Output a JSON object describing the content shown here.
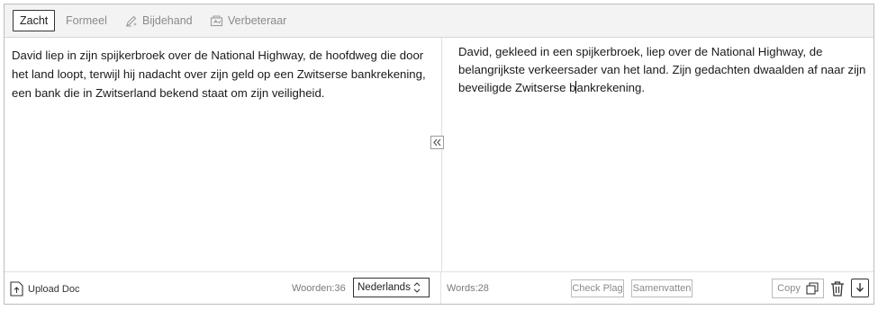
{
  "tabs": [
    {
      "label": "Zacht",
      "active": true
    },
    {
      "label": "Formeel",
      "active": false
    },
    {
      "label": "Bijdehand",
      "active": false,
      "icon": "pen-sparkle-icon"
    },
    {
      "label": "Verbeteraar",
      "active": false,
      "icon": "proofread-icon"
    }
  ],
  "input": {
    "text": "David liep in zijn spijkerbroek over de National Highway, de hoofdweg die door het land loopt, terwijl hij nadacht over zijn geld op een Zwitserse bankrekening, een bank die in Zwitserland bekend staat om zijn veiligheid."
  },
  "output": {
    "text_before_caret": "David, gekleed in een spijkerbroek, liep over de National Highway, de belangrijkste verkeersader van het land. Zijn gedachten dwaalden af naar zijn beveiligde Zwitserse b",
    "text_after_caret": "ankrekening."
  },
  "footer_left": {
    "upload_label": "Upload Doc",
    "word_count": "Woorden:36",
    "language": "Nederlands"
  },
  "footer_right": {
    "word_count": "Words:28",
    "check_plag_label": "Check Plag",
    "summarize_label": "Samenvatten",
    "copy_label": "Copy"
  },
  "icons": {
    "collapse": "double-chevron-left-icon",
    "upload": "upload-icon",
    "language_toggle": "up-down-chevron-icon",
    "copy": "copy-icon",
    "delete": "trash-icon",
    "download": "download-icon"
  }
}
